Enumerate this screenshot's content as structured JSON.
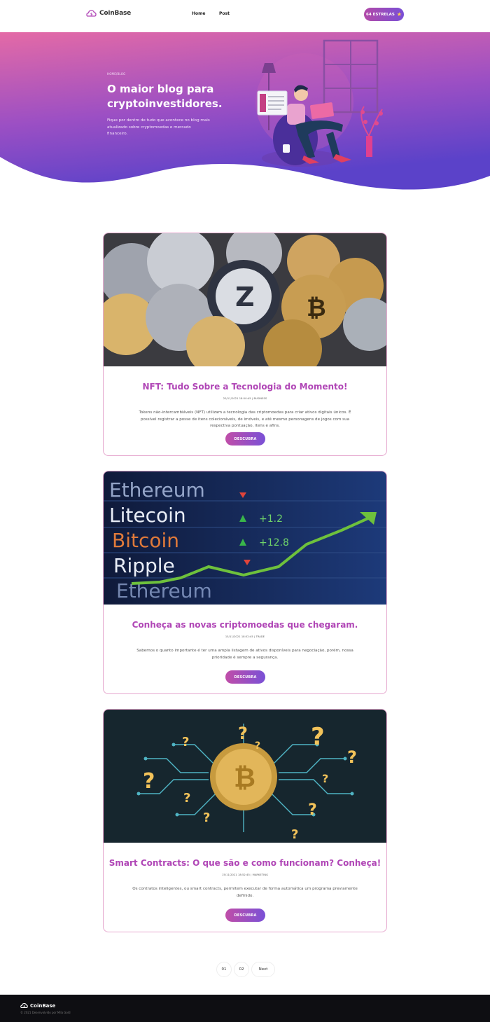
{
  "header": {
    "brand": "CoinBase",
    "nav": [
      "Home",
      "Post"
    ],
    "stars_label": "64 ESTRELAS"
  },
  "hero": {
    "breadcrumb": "HOME/BLOG",
    "title": "O maior blog para cryptoinvestidores.",
    "description": "Fique por dentro de tudo que acontece no blog mais atualizado sobre cryptomoedas e mercado financeiro."
  },
  "posts": [
    {
      "title": "NFT: Tudo Sobre a Tecnologia do Momento!",
      "meta": "20/11/2021 18:50:45 | BUSINESS",
      "text": "Tokens não-intercambiáveis (NFT) utilizam a tecnologia das criptomoedas para criar ativos digitais únicos. É possível registrar a posse de itens colecionáveis, de imóveis, e até mesmo personagens de jogos com sua respectiva pontuação, itens e afins.",
      "button": "DESCUBRA"
    },
    {
      "title": "Conheça as novas criptomoedas que chegaram.",
      "meta": "15/11/2021 18:52:45 | TRADE",
      "text": "Sabemos o quanto importante é ter uma ampla listagem de ativos disponíveis para negociação, porém, nossa prioridade é sempre a segurança.",
      "button": "DESCUBRA"
    },
    {
      "title": "Smart Contracts: O que são e como funcionam? Conheça!",
      "meta": "15/11/2021 18:52:45 | MARKETING",
      "text": "Os contratos inteligentes, ou smart contracts, permitem executar de forma automática um programa previamente definido.",
      "button": "DESCUBRA"
    }
  ],
  "ticker": {
    "names": [
      "Ethereum",
      "Litecoin",
      "Bitcoin",
      "Ripple",
      "Ethereum"
    ],
    "values": [
      "+1.2",
      "+12.8"
    ]
  },
  "pagination": [
    "01",
    "02",
    "Next"
  ],
  "footer": {
    "brand": "CoinBase",
    "copyright": "© 2021 Desenvolvido por Mila Gold"
  },
  "colors": {
    "accent_pink": "#b046b6",
    "hero_top": "#e46aa6",
    "hero_bottom": "#5b42c9",
    "footer_bg": "#0e0e12"
  }
}
